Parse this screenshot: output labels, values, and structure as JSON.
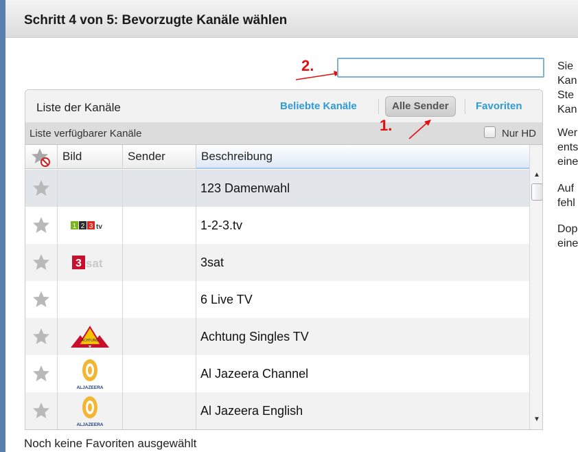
{
  "window": {
    "title": "Schritt 4 von 5: Bevorzugte Kanäle wählen"
  },
  "annotations": {
    "step1": "1.",
    "step2": "2.",
    "color": "#e01010"
  },
  "search": {
    "value": ""
  },
  "side_text": [
    "Sie\nKan\nSte\nKan",
    "Wer\nents\neine",
    "Auf\nfehl",
    "Dop\neine"
  ],
  "panel": {
    "title": "Liste der Kanäle",
    "tabs": [
      {
        "label": "Beliebte Kanäle",
        "active": false
      },
      {
        "label": "Alle Sender",
        "active": true
      },
      {
        "label": "Favoriten",
        "active": false
      }
    ],
    "subtitle": "Liste verfügbarer Kanäle",
    "hd_checkbox": {
      "label": "Nur HD",
      "checked": false
    }
  },
  "grid": {
    "columns": [
      {
        "label": "",
        "icon": "favorite-filter-icon"
      },
      {
        "label": "Bild"
      },
      {
        "label": "Sender"
      },
      {
        "label": "Beschreibung",
        "sorted": true
      }
    ],
    "rows": [
      {
        "logo": "",
        "sender": "",
        "description": "123 Damenwahl",
        "favorite": false
      },
      {
        "logo": "123tv-logo",
        "logo_text": "123tv",
        "sender": "",
        "description": "1-2-3.tv",
        "favorite": false
      },
      {
        "logo": "3sat-logo",
        "logo_text": "3sat",
        "sender": "",
        "description": "3sat",
        "favorite": false
      },
      {
        "logo": "",
        "sender": "",
        "description": "6 Live TV",
        "favorite": false
      },
      {
        "logo": "achtung-singles-logo",
        "logo_text": "Achtung Singles",
        "sender": "",
        "description": "Achtung Singles TV",
        "favorite": false
      },
      {
        "logo": "aljazeera-logo",
        "logo_text": "ALJAZEERA",
        "sender": "",
        "description": "Al Jazeera Channel",
        "favorite": false
      },
      {
        "logo": "aljazeera-logo",
        "logo_text": "ALJAZEERA",
        "sender": "",
        "description": "Al Jazeera English",
        "favorite": false
      }
    ]
  },
  "footer": {
    "text": "Noch keine Favoriten ausgewählt"
  },
  "colors": {
    "accent": "#2e9ad6",
    "annotation": "#e01010",
    "star": "#b9b9b9"
  }
}
